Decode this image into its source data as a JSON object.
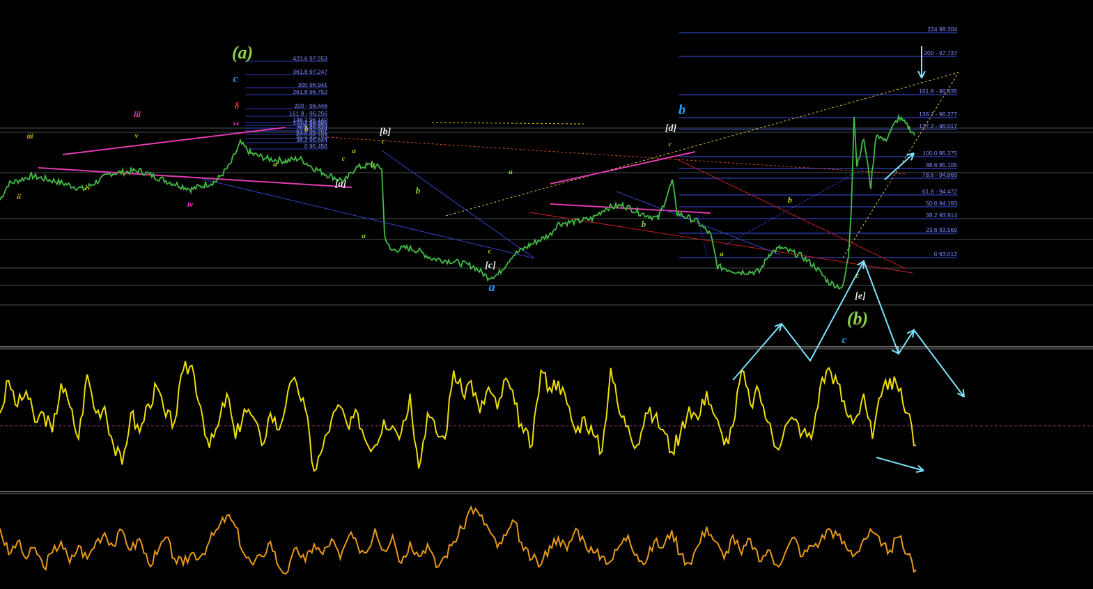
{
  "colors": {
    "background": "#000000",
    "price_series": "#2e9e2e",
    "oscillator_1": "#f0e000",
    "oscillator_2": "#e89a1c",
    "fib_lines": "#3c4ff0",
    "fib_text": "#7f8cff",
    "trendline_magenta": "#e23bb0",
    "trendline_red": "#c81e1e",
    "trendline_blue": "#3344cc",
    "projection_arrows": "#7fe5ff"
  },
  "chart_data": [
    {
      "type": "line",
      "name": "price panel",
      "y_unit": "price",
      "ylim": [
        92.2,
        98.6
      ],
      "series_path": [
        [
          0,
          94.85
        ],
        [
          12,
          95.15
        ],
        [
          45,
          95.3
        ],
        [
          80,
          95.2
        ],
        [
          120,
          95.05
        ],
        [
          160,
          95.35
        ],
        [
          200,
          95.4
        ],
        [
          240,
          95.2
        ],
        [
          275,
          95.05
        ],
        [
          310,
          95.2
        ],
        [
          330,
          95.5
        ],
        [
          345,
          95.92
        ],
        [
          360,
          95.72
        ],
        [
          385,
          95.62
        ],
        [
          410,
          95.58
        ],
        [
          430,
          95.63
        ],
        [
          450,
          95.45
        ],
        [
          470,
          95.32
        ],
        [
          495,
          95.2
        ],
        [
          510,
          95.45
        ],
        [
          530,
          95.5
        ],
        [
          548,
          95.45
        ],
        [
          552,
          94.2
        ],
        [
          560,
          93.9
        ],
        [
          585,
          93.95
        ],
        [
          600,
          93.9
        ],
        [
          620,
          93.75
        ],
        [
          650,
          93.7
        ],
        [
          680,
          93.6
        ],
        [
          700,
          93.4
        ],
        [
          715,
          93.45
        ],
        [
          735,
          93.8
        ],
        [
          760,
          94.0
        ],
        [
          790,
          94.2
        ],
        [
          800,
          94.4
        ],
        [
          830,
          94.45
        ],
        [
          850,
          94.5
        ],
        [
          870,
          94.7
        ],
        [
          895,
          94.75
        ],
        [
          920,
          94.6
        ],
        [
          945,
          94.5
        ],
        [
          965,
          95.2
        ],
        [
          972,
          94.6
        ],
        [
          1000,
          94.45
        ],
        [
          1020,
          94.2
        ],
        [
          1030,
          93.6
        ],
        [
          1060,
          93.5
        ],
        [
          1090,
          93.5
        ],
        [
          1105,
          93.85
        ],
        [
          1120,
          93.95
        ],
        [
          1150,
          93.8
        ],
        [
          1170,
          93.6
        ],
        [
          1190,
          93.3
        ],
        [
          1210,
          93.2
        ],
        [
          1218,
          93.8
        ],
        [
          1222,
          94.7
        ],
        [
          1226,
          96.45
        ],
        [
          1230,
          95.5
        ],
        [
          1240,
          96.0
        ],
        [
          1250,
          95.1
        ],
        [
          1258,
          96.1
        ],
        [
          1270,
          95.95
        ],
        [
          1290,
          96.4
        ],
        [
          1305,
          96.2
        ],
        [
          1315,
          96.05
        ]
      ],
      "fib_retracement_right": [
        {
          "label": "224 98.304"
        },
        {
          "label": "200 - 97.737"
        },
        {
          "label": "161.8 - 96.835"
        },
        {
          "label": "138.2 - 96.277"
        },
        {
          "label": "127.2 - 96.017"
        },
        {
          "label": "100.0 95.375"
        },
        {
          "label": "88.6 95.105"
        },
        {
          "label": "78.6 - 94.869"
        },
        {
          "label": "61.8 - 94.472"
        },
        {
          "label": "50.0 94.193"
        },
        {
          "label": "38.2 93.914"
        },
        {
          "label": "23.6 93.569"
        },
        {
          "label": "0 93.012"
        }
      ],
      "fib_extension_left": [
        {
          "label": "423.6 97.553"
        },
        {
          "label": "361.8 97.247"
        },
        {
          "label": "300 96.941"
        },
        {
          "label": "261.8 96.752"
        },
        {
          "label": "200 - 96.446"
        },
        {
          "label": "161.8 - 96.256"
        },
        {
          "label": "138.2 96.140"
        },
        {
          "label": "127.2 96.085"
        },
        {
          "label": "100 95.950"
        },
        {
          "label": "78.6 95.844"
        },
        {
          "label": "61.8 95.761"
        },
        {
          "label": "50.0 95.703"
        },
        {
          "label": "38.2 95.644"
        },
        {
          "label": "0 95.456"
        }
      ],
      "wave_labels": [
        {
          "text": "(a)",
          "color": "#8cd14a"
        },
        {
          "text": "c",
          "color": "#1ea0ff"
        },
        {
          "text": "δ",
          "color": "#ff3333"
        },
        {
          "text": "vx",
          "color": "#ff3bd0"
        },
        {
          "text": "iii",
          "color": "#ff3bd0"
        },
        {
          "text": "iii",
          "color": "#c8b400"
        },
        {
          "text": "v",
          "color": "#c8b400"
        },
        {
          "text": "ii",
          "color": "#c8b400"
        },
        {
          "text": "iv",
          "color": "#c8b400"
        },
        {
          "text": "iv",
          "color": "#ff3bd0"
        },
        {
          "text": "a",
          "color": "#c8d400"
        },
        {
          "text": "b",
          "color": "#c8d400"
        },
        {
          "text": "c",
          "color": "#c8d400"
        },
        {
          "text": "[a]",
          "color": "#f0f0f0"
        },
        {
          "text": "[b]",
          "color": "#f0f0f0"
        },
        {
          "text": "a",
          "color": "#c8d400"
        },
        {
          "text": "b",
          "color": "#8cd14a"
        },
        {
          "text": "c",
          "color": "#c8d400"
        },
        {
          "text": "b",
          "color": "#8cd14a"
        },
        {
          "text": "a",
          "color": "#8cd14a"
        },
        {
          "text": "a",
          "color": "#8cd14a"
        },
        {
          "text": "c",
          "color": "#c8d400"
        },
        {
          "text": "[c]",
          "color": "#f0f0f0"
        },
        {
          "text": "a",
          "color": "#1ea0ff"
        },
        {
          "text": "b",
          "color": "#1ea0ff"
        },
        {
          "text": "[d]",
          "color": "#f0f0f0"
        },
        {
          "text": "c",
          "color": "#c8d400"
        },
        {
          "text": "b",
          "color": "#8cd14a"
        },
        {
          "text": "a",
          "color": "#c8d400"
        },
        {
          "text": "b",
          "color": "#c8d400"
        },
        {
          "text": "c",
          "color": "#c8d400"
        },
        {
          "text": "[e]",
          "color": "#f0f0f0"
        },
        {
          "text": "(b)",
          "color": "#8cd14a"
        },
        {
          "text": "c",
          "color": "#1ea0ff"
        }
      ]
    },
    {
      "type": "line",
      "name": "oscillator panel 1",
      "ylim": [
        0,
        100
      ],
      "midline": 45,
      "values": [
        55,
        80,
        60,
        72,
        48,
        55,
        40,
        78,
        60,
        35,
        85,
        55,
        60,
        30,
        15,
        55,
        40,
        62,
        75,
        52,
        48,
        88,
        92,
        60,
        28,
        45,
        70,
        35,
        58,
        52,
        30,
        55,
        42,
        72,
        78,
        58,
        10,
        28,
        50,
        60,
        42,
        55,
        32,
        30,
        50,
        45,
        40,
        70,
        12,
        55,
        40,
        35,
        88,
        70,
        80,
        55,
        75,
        58,
        82,
        62,
        40,
        30,
        88,
        75,
        80,
        62,
        40,
        52,
        38,
        25,
        90,
        55,
        45,
        30,
        55,
        52,
        42,
        25,
        40,
        60,
        50,
        72,
        52,
        30,
        45,
        88,
        62,
        72,
        48,
        28,
        45,
        50,
        40,
        35,
        75,
        90,
        78,
        55,
        50,
        70,
        35,
        68,
        82,
        72,
        55,
        30
      ]
    },
    {
      "type": "line",
      "name": "oscillator panel 2",
      "ylim": [
        0,
        100
      ],
      "values": [
        70,
        40,
        55,
        35,
        48,
        25,
        42,
        55,
        30,
        50,
        35,
        55,
        65,
        50,
        68,
        45,
        58,
        30,
        40,
        60,
        35,
        28,
        42,
        38,
        55,
        70,
        85,
        72,
        40,
        28,
        38,
        55,
        25,
        20,
        48,
        32,
        52,
        40,
        58,
        35,
        62,
        50,
        42,
        70,
        45,
        62,
        30,
        55,
        38,
        52,
        25,
        38,
        55,
        70,
        95,
        85,
        70,
        48,
        62,
        78,
        45,
        35,
        28,
        50,
        60,
        45,
        70,
        55,
        42,
        38,
        32,
        50,
        62,
        40,
        30,
        55,
        48,
        68,
        40,
        30,
        50,
        72,
        55,
        35,
        62,
        40,
        58,
        32,
        45,
        28,
        42,
        60,
        38,
        50,
        55,
        70,
        62,
        48,
        40,
        58,
        66,
        50,
        45,
        60,
        40,
        22
      ]
    }
  ]
}
